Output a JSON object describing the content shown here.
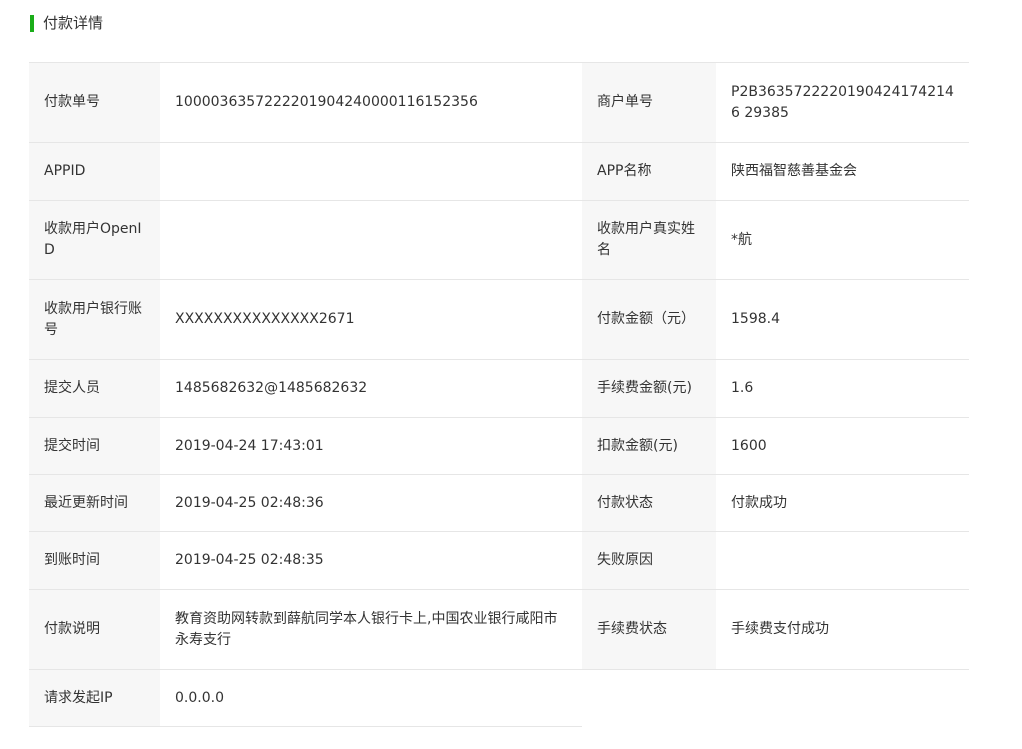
{
  "section": {
    "title": "付款详情",
    "accent_color": "#1aad19"
  },
  "fields": {
    "payment_no": {
      "label": "付款单号",
      "value": "1000036357222201904240000116152356"
    },
    "merchant_no": {
      "label": "商户单号",
      "value": "P2B36357222201904241742146 29385"
    },
    "appid": {
      "label": "APPID",
      "value": ""
    },
    "app_name": {
      "label": "APP名称",
      "value": "陕西福智慈善基金会"
    },
    "payee_openid": {
      "label": "收款用户OpenID",
      "value": ""
    },
    "payee_real_name": {
      "label": "收款用户真实姓名",
      "value": "*航"
    },
    "payee_bank_account": {
      "label": "收款用户银行账号",
      "value": "XXXXXXXXXXXXXXX2671"
    },
    "payment_amount": {
      "label": "付款金额（元）",
      "value": "1598.4"
    },
    "submitter": {
      "label": "提交人员",
      "value": "1485682632@1485682632"
    },
    "fee_amount": {
      "label": "手续费金额(元)",
      "value": "1.6"
    },
    "submit_time": {
      "label": "提交时间",
      "value": "2019-04-24 17:43:01"
    },
    "deduct_amount": {
      "label": "扣款金额(元)",
      "value": "1600"
    },
    "last_update_time": {
      "label": "最近更新时间",
      "value": "2019-04-25 02:48:36"
    },
    "payment_status": {
      "label": "付款状态",
      "value": "付款成功"
    },
    "arrival_time": {
      "label": "到账时间",
      "value": "2019-04-25 02:48:35"
    },
    "failure_reason": {
      "label": "失败原因",
      "value": ""
    },
    "payment_note": {
      "label": "付款说明",
      "value": "教育资助网转款到薛航同学本人银行卡上,中国农业银行咸阳市永寿支行"
    },
    "fee_status": {
      "label": "手续费状态",
      "value": "手续费支付成功"
    },
    "request_ip": {
      "label": "请求发起IP",
      "value": "0.0.0.0"
    }
  }
}
